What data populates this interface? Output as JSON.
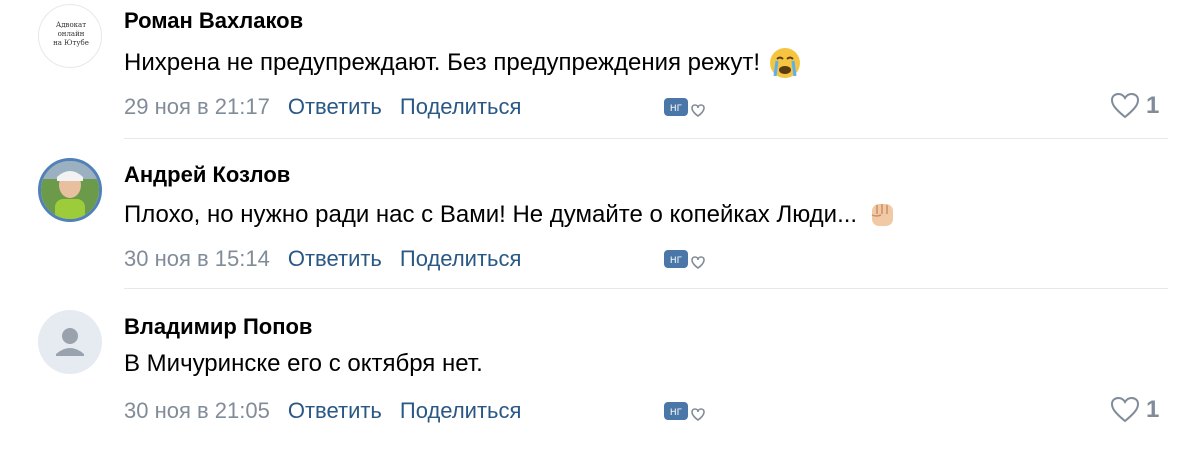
{
  "comments": [
    {
      "author": "Роман Вахлаков",
      "text": "Нихрена не предупреждают. Без предупреждения режут!",
      "emoji": "crying-face",
      "date": "29 ноя в 21:17",
      "reply_label": "Ответить",
      "share_label": "Поделиться",
      "likes": "1",
      "avatar_caption": "Адвокат\nонлайн\nна Ютубе"
    },
    {
      "author": "Андрей Козлов",
      "text": "Плохо, но нужно ради нас с Вами! Не думайте о копейках Люди...",
      "emoji": "raised-fist",
      "date": "30 ноя в 15:14",
      "reply_label": "Ответить",
      "share_label": "Поделиться",
      "likes": null
    },
    {
      "author": "Владимир Попов",
      "text": "В Мичуринске его с октября нет.",
      "emoji": null,
      "date": "30 ноя в 21:05",
      "reply_label": "Ответить",
      "share_label": "Поделиться",
      "likes": "1"
    }
  ],
  "colors": {
    "link": "#2a5885",
    "meta": "#818c99",
    "divider": "#e7e8ec",
    "reaction_badge": "#4a76a8"
  }
}
